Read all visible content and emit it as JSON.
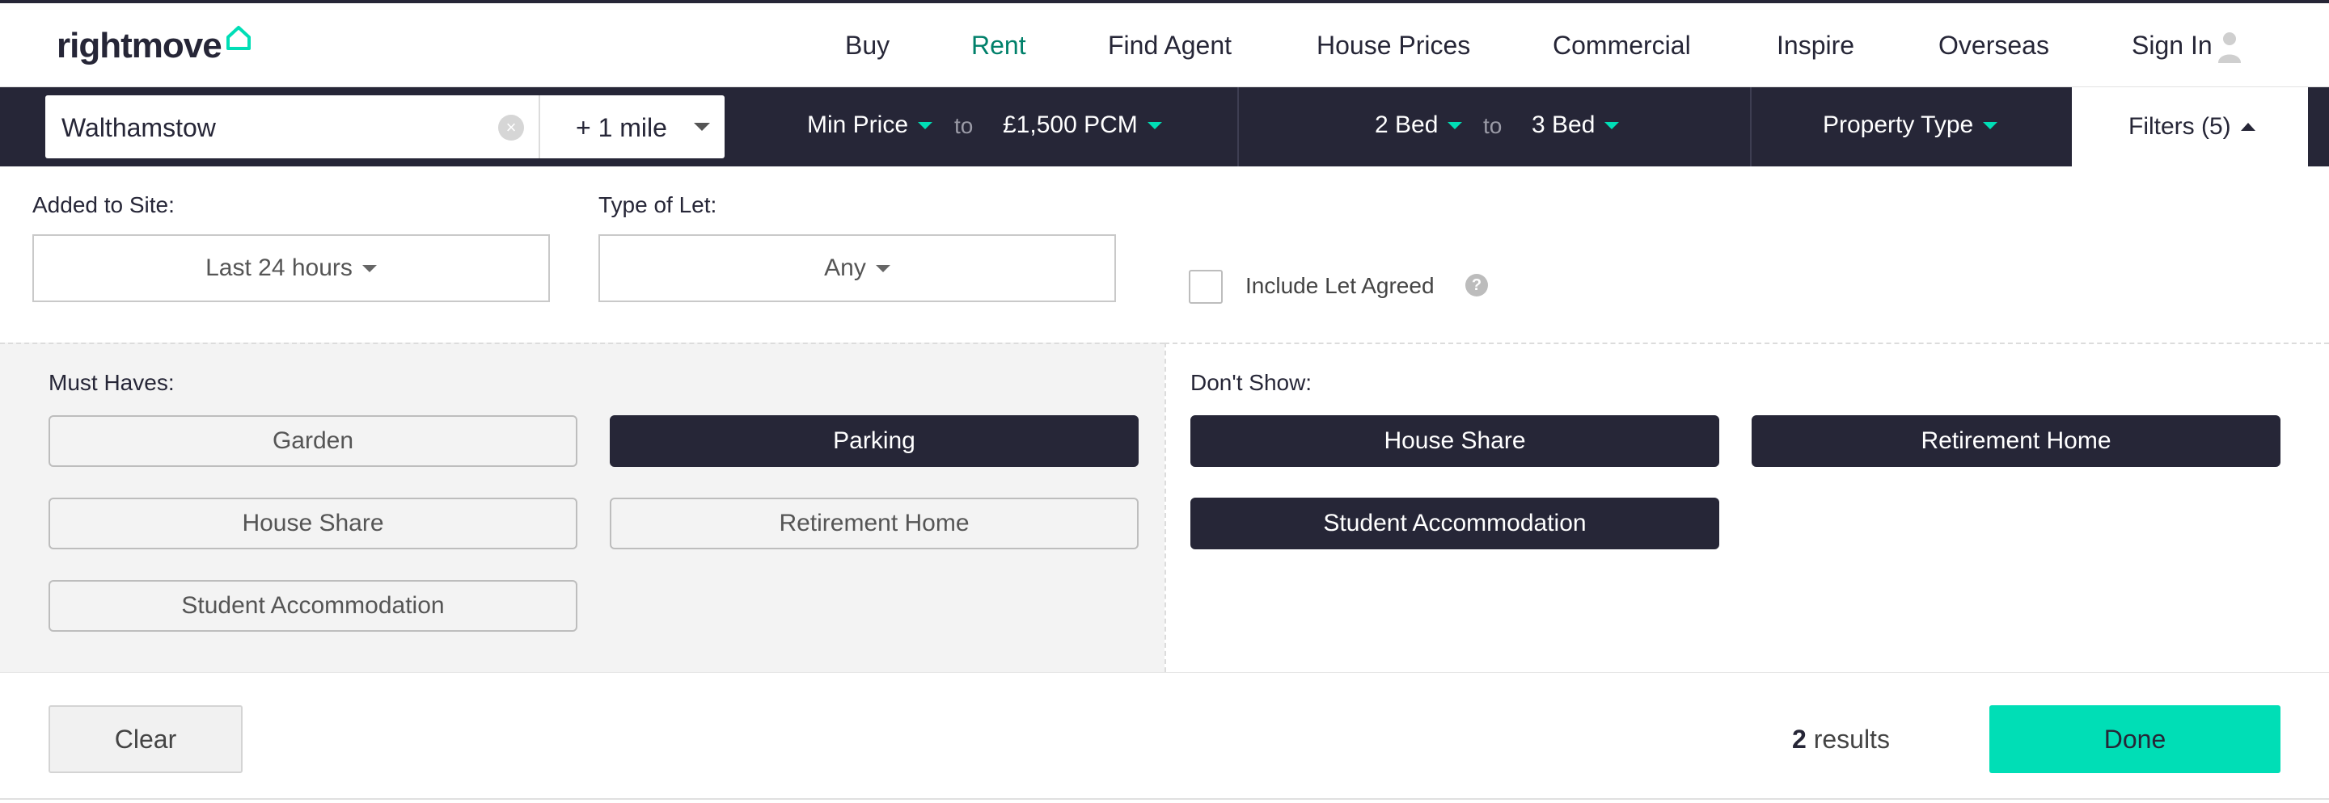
{
  "header": {
    "logo_text": "rightmove",
    "nav": [
      {
        "label": "Buy",
        "active": false
      },
      {
        "label": "Rent",
        "active": true
      },
      {
        "label": "Find Agent",
        "active": false
      },
      {
        "label": "House Prices",
        "active": false
      },
      {
        "label": "Commercial",
        "active": false
      },
      {
        "label": "Inspire",
        "active": false
      },
      {
        "label": "Overseas",
        "active": false
      },
      {
        "label": "Sign In",
        "active": false
      }
    ]
  },
  "search": {
    "location": "Walthamstow",
    "radius": "+ 1 mile",
    "min_price": "Min Price",
    "to_1": "to",
    "max_price": "£1,500 PCM",
    "min_beds": "2 Bed",
    "to_2": "to",
    "max_beds": "3 Bed",
    "property_type": "Property Type",
    "filters": "Filters (5)"
  },
  "filters": {
    "added_label": "Added to Site:",
    "added_value": "Last 24 hours",
    "let_type_label": "Type of Let:",
    "let_type_value": "Any",
    "include_let_agreed": "Include Let Agreed",
    "include_let_agreed_checked": false,
    "help_glyph": "?",
    "must_haves_label": "Must Haves:",
    "must_haves": [
      {
        "label": "Garden",
        "selected": false
      },
      {
        "label": "Parking",
        "selected": true
      },
      {
        "label": "House Share",
        "selected": false
      },
      {
        "label": "Retirement Home",
        "selected": false
      },
      {
        "label": "Student Accommodation",
        "selected": false
      }
    ],
    "dont_show_label": "Don't Show:",
    "dont_show": [
      {
        "label": "House Share",
        "selected": true
      },
      {
        "label": "Retirement Home",
        "selected": true
      },
      {
        "label": "Student Accommodation",
        "selected": true
      }
    ]
  },
  "footer": {
    "clear": "Clear",
    "results_count": "2",
    "results_text": "results",
    "done": "Done"
  },
  "colors": {
    "navy": "#262637",
    "accent": "#00deb6",
    "active_nav": "#00806a"
  }
}
